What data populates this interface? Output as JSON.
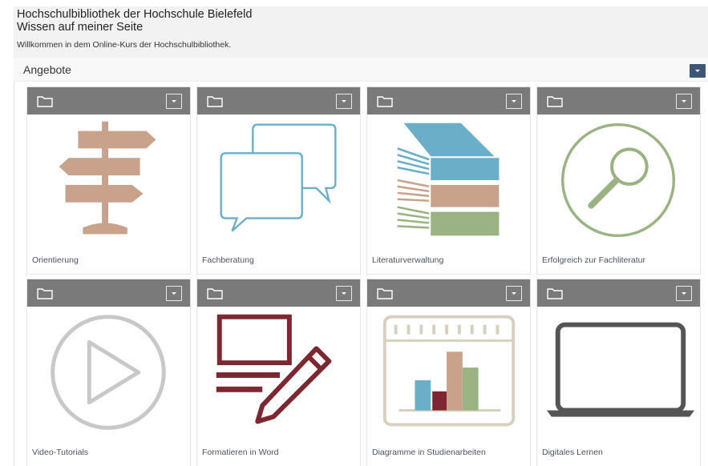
{
  "header": {
    "title_line1": "Hochschulbibliothek der Hochschule Bielefeld",
    "title_line2": "Wissen auf meiner Seite",
    "welcome": "Willkommen in dem Online-Kurs der Hochschulbibliothek."
  },
  "section": {
    "title": "Angebote",
    "toggle_icon": "chevron-down-icon"
  },
  "colors": {
    "bar_gray": "#7a7a7a",
    "section_toggle": "#3d5677",
    "tan": "#c9a28c",
    "blue": "#6aaec8",
    "green": "#9bb283",
    "maroon": "#7d2730",
    "light_gray": "#c8c8c8"
  },
  "tiles": [
    {
      "label": "Orientierung",
      "icon": "signpost-icon"
    },
    {
      "label": "Fachberatung",
      "icon": "speech-bubbles-icon"
    },
    {
      "label": "Literaturverwaltung",
      "icon": "books-stack-icon"
    },
    {
      "label": "Erfolgreich zur Fachliteratur",
      "icon": "magnifier-icon"
    },
    {
      "label": "Video-Tutorials",
      "icon": "play-icon"
    },
    {
      "label": "Formatieren in Word",
      "icon": "document-pen-icon"
    },
    {
      "label": "Diagramme in Studienarbeiten",
      "icon": "bar-chart-icon"
    },
    {
      "label": "Digitales Lernen",
      "icon": "laptop-icon"
    }
  ]
}
